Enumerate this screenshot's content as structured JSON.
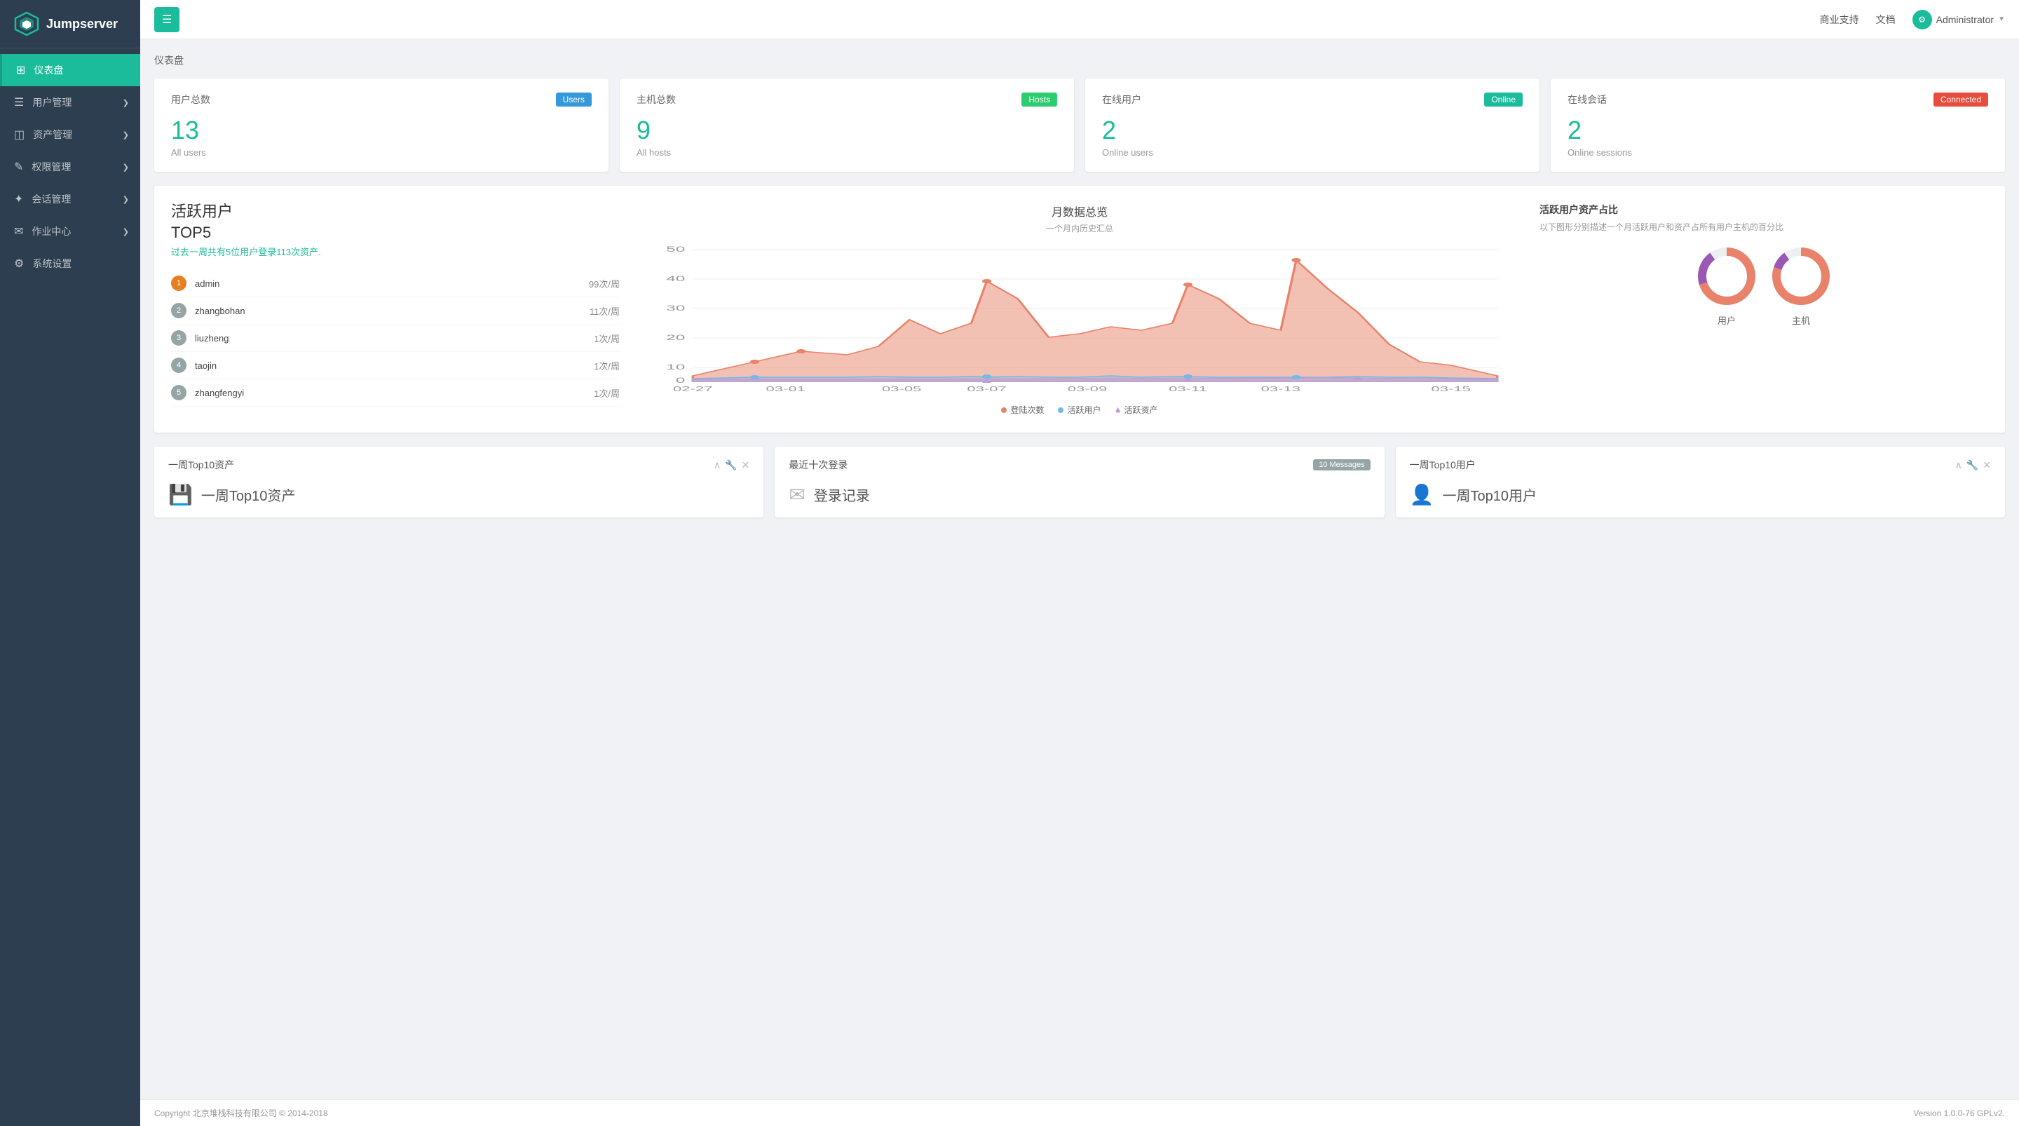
{
  "app": {
    "name": "Jumpserver",
    "version": "Version 1.0.0-76 GPLv2."
  },
  "header": {
    "business_support": "商业支持",
    "docs": "文档",
    "user": "Administrator"
  },
  "breadcrumb": "仪表盘",
  "sidebar": {
    "items": [
      {
        "id": "dashboard",
        "label": "仪表盘",
        "icon": "📊",
        "active": true
      },
      {
        "id": "users",
        "label": "用户管理",
        "icon": "👥",
        "has_arrow": true
      },
      {
        "id": "assets",
        "label": "资产管理",
        "icon": "🖥",
        "has_arrow": true
      },
      {
        "id": "permissions",
        "label": "权限管理",
        "icon": "🔑",
        "has_arrow": true
      },
      {
        "id": "sessions",
        "label": "会话管理",
        "icon": "💬",
        "has_arrow": true
      },
      {
        "id": "jobs",
        "label": "作业中心",
        "icon": "⚙",
        "has_arrow": true
      },
      {
        "id": "settings",
        "label": "系统设置",
        "icon": "🔧",
        "has_arrow": false
      }
    ]
  },
  "stats": [
    {
      "title": "用户总数",
      "badge": "Users",
      "badge_class": "badge-users",
      "number": "13",
      "label": "All users"
    },
    {
      "title": "主机总数",
      "badge": "Hosts",
      "badge_class": "badge-hosts",
      "number": "9",
      "label": "All hosts"
    },
    {
      "title": "在线用户",
      "badge": "Online",
      "badge_class": "badge-online",
      "number": "2",
      "label": "Online users"
    },
    {
      "title": "在线会话",
      "badge": "Connected",
      "badge_class": "badge-connected",
      "number": "2",
      "label": "Online sessions"
    }
  ],
  "active_users": {
    "title": "活跃用户",
    "subtitle": "TOP5",
    "desc_prefix": "过去一周共有5位用户登录",
    "desc_highlight": "113",
    "desc_suffix": "次资产.",
    "users": [
      {
        "rank": 1,
        "name": "admin",
        "count": "99次/周"
      },
      {
        "rank": 2,
        "name": "zhangbohan",
        "count": "11次/周"
      },
      {
        "rank": 3,
        "name": "liuzheng",
        "count": "1次/周"
      },
      {
        "rank": 4,
        "name": "taojin",
        "count": "1次/周"
      },
      {
        "rank": 5,
        "name": "zhangfengyi",
        "count": "1次/周"
      }
    ]
  },
  "chart": {
    "title": "月数据总览",
    "subtitle": "一个月内历史汇总",
    "legend": [
      {
        "label": "登陆次数",
        "color": "#e8826a"
      },
      {
        "label": "活跃用户",
        "color": "#74b9e8"
      },
      {
        "label": "活跃资产",
        "color": "#c39bd3"
      }
    ]
  },
  "donut_section": {
    "title": "活跃用户资产占比",
    "subtitle": "以下图形分别描述一个月活跃用户和资产占所有用户主机的百分比",
    "items": [
      {
        "label": "用户",
        "user_pct": 70,
        "other_pct": 30
      },
      {
        "label": "主机",
        "user_pct": 80,
        "other_pct": 20
      }
    ]
  },
  "bottom": [
    {
      "title": "一周Top10资产",
      "icon": "💾",
      "body": "一周Top10资产",
      "msg": null
    },
    {
      "title": "最近十次登录",
      "icon": "✈",
      "body": "登录记录",
      "msg": "10 Messages"
    },
    {
      "title": "一周Top10用户",
      "icon": "👤",
      "body": "一周Top10用户",
      "msg": null
    }
  ],
  "footer": {
    "copyright": "Copyright 北京堆栈科技有限公司 © 2014-2018",
    "version": "Version 1.0.0-76 GPLv2."
  }
}
